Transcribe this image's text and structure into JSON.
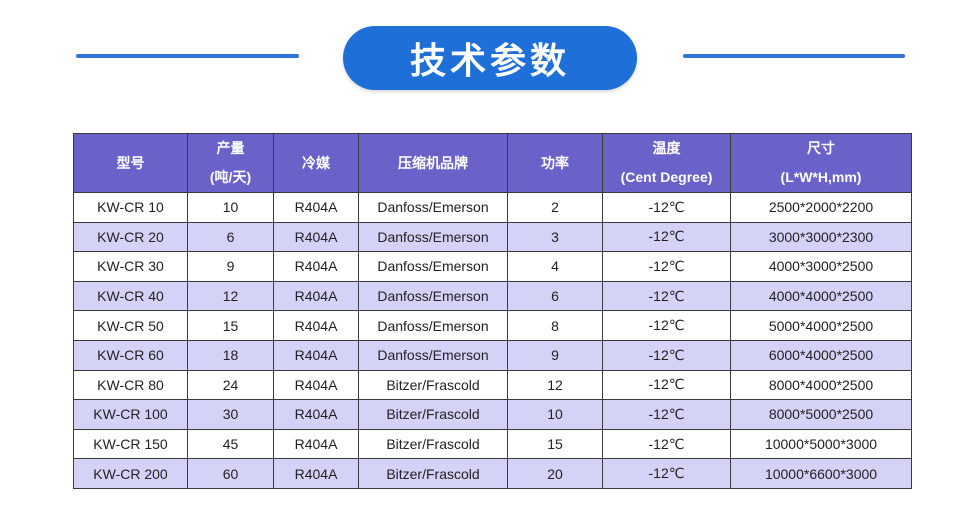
{
  "title": "技术参数",
  "table": {
    "headers": [
      {
        "line1": "型号",
        "line2": ""
      },
      {
        "line1": "产量",
        "line2": "(吨/天)"
      },
      {
        "line1": "冷媒",
        "line2": ""
      },
      {
        "line1": "压缩机品牌",
        "line2": ""
      },
      {
        "line1": "功率",
        "line2": ""
      },
      {
        "line1": "温度",
        "line2": "(Cent Degree)"
      },
      {
        "line1": "尺寸",
        "line2": "(L*W*H,mm)"
      }
    ],
    "rows": [
      [
        "KW-CR 10",
        "10",
        "R404A",
        "Danfoss/Emerson",
        "2",
        "-12℃",
        "2500*2000*2200"
      ],
      [
        "KW-CR 20",
        "6",
        "R404A",
        "Danfoss/Emerson",
        "3",
        "-12℃",
        "3000*3000*2300"
      ],
      [
        "KW-CR 30",
        "9",
        "R404A",
        "Danfoss/Emerson",
        "4",
        "-12℃",
        "4000*3000*2500"
      ],
      [
        "KW-CR 40",
        "12",
        "R404A",
        "Danfoss/Emerson",
        "6",
        "-12℃",
        "4000*4000*2500"
      ],
      [
        "KW-CR 50",
        "15",
        "R404A",
        "Danfoss/Emerson",
        "8",
        "-12℃",
        "5000*4000*2500"
      ],
      [
        "KW-CR 60",
        "18",
        "R404A",
        "Danfoss/Emerson",
        "9",
        "-12℃",
        "6000*4000*2500"
      ],
      [
        "KW-CR 80",
        "24",
        "R404A",
        "Bitzer/Frascold",
        "12",
        "-12℃",
        "8000*4000*2500"
      ],
      [
        "KW-CR 100",
        "30",
        "R404A",
        "Bitzer/Frascold",
        "10",
        "-12℃",
        "8000*5000*2500"
      ],
      [
        "KW-CR 150",
        "45",
        "R404A",
        "Bitzer/Frascold",
        "15",
        "-12℃",
        "10000*5000*3000"
      ],
      [
        "KW-CR 200",
        "60",
        "R404A",
        "Bitzer/Frascold",
        "20",
        "-12℃",
        "10000*6600*3000"
      ]
    ]
  },
  "colors": {
    "accent_blue": "#1e6fd8",
    "header_purple": "#6a62c9",
    "stripe_lavender": "#d5d2f8"
  }
}
